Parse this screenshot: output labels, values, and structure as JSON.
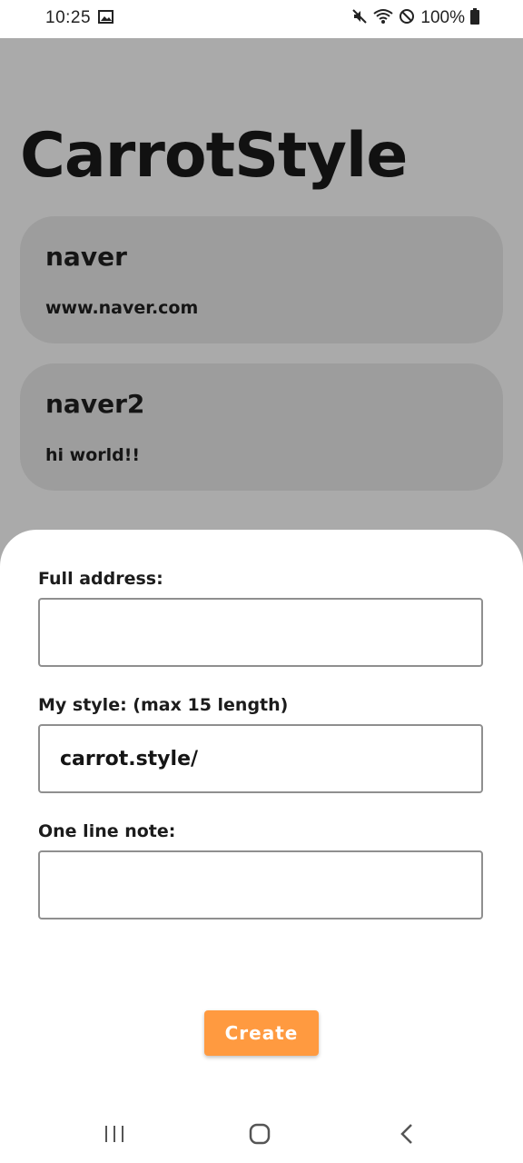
{
  "status_bar": {
    "time": "10:25",
    "battery": "100%",
    "icons": [
      "image-icon",
      "mute-icon",
      "wifi-icon",
      "do-not-disturb-icon",
      "battery-icon"
    ]
  },
  "app": {
    "title": "CarrotStyle"
  },
  "cards": [
    {
      "title": "naver",
      "subtitle": "www.naver.com"
    },
    {
      "title": "naver2",
      "subtitle": "hi world!!"
    }
  ],
  "form": {
    "full_address_label": "Full address:",
    "full_address_value": "",
    "style_label": "My style: (max 15 length)",
    "style_value": "carrot.style/",
    "note_label": "One line note:",
    "note_value": "",
    "create_label": "Create"
  },
  "colors": {
    "accent": "#ff9a40",
    "overlay": "#aaaaaa",
    "card": "#9d9d9d"
  },
  "nav": {
    "icons": [
      "recents-icon",
      "home-icon",
      "back-icon"
    ]
  }
}
